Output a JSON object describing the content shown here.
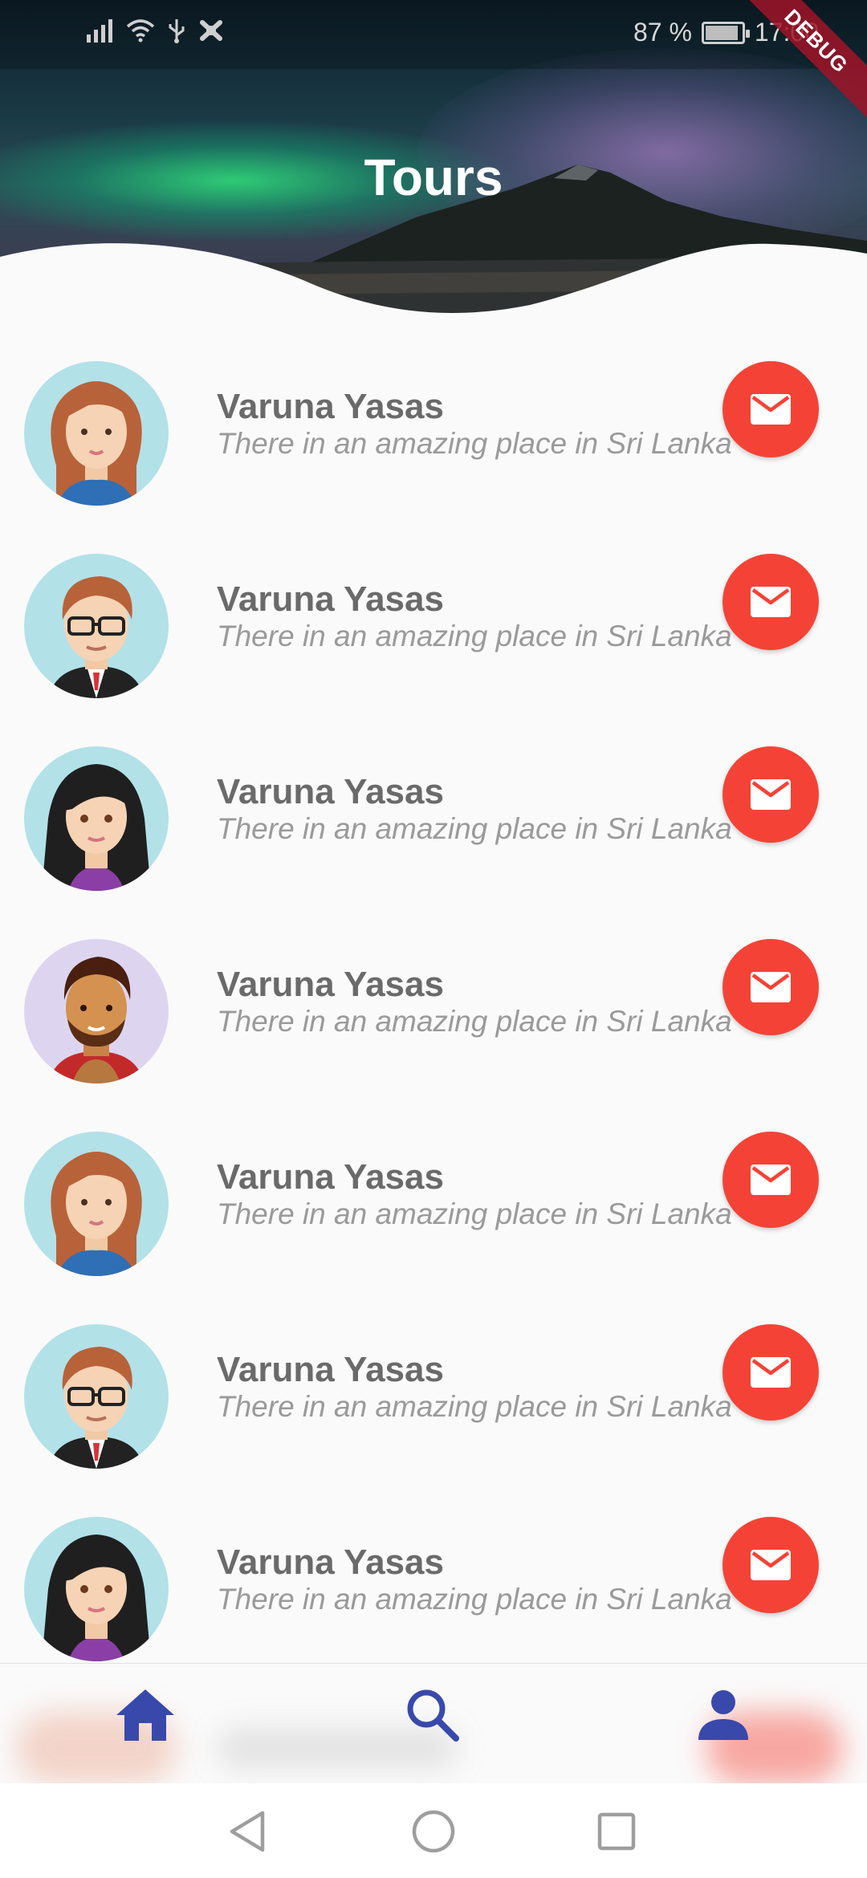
{
  "status_bar": {
    "battery_percent": "87 %",
    "time": "17:00",
    "debug_label": "DEBUG",
    "icons": [
      "signal-icon",
      "wifi-icon",
      "usb-icon",
      "notification-icon"
    ]
  },
  "header": {
    "title": "Tours"
  },
  "tours": [
    {
      "name": "Varuna Yasas",
      "description": "There in an amazing place in Sri Lanka",
      "avatar": "woman-redhair-avatar"
    },
    {
      "name": "Varuna Yasas",
      "description": "There in an amazing place in Sri Lanka",
      "avatar": "man-glasses-avatar"
    },
    {
      "name": "Varuna Yasas",
      "description": "There in an amazing place in Sri Lanka",
      "avatar": "woman-darkhair-avatar"
    },
    {
      "name": "Varuna Yasas",
      "description": "There in an amazing place in Sri Lanka",
      "avatar": "man-beard-avatar"
    },
    {
      "name": "Varuna Yasas",
      "description": "There in an amazing place in Sri Lanka",
      "avatar": "woman-redhair-avatar"
    },
    {
      "name": "Varuna Yasas",
      "description": "There in an amazing place in Sri Lanka",
      "avatar": "man-glasses-avatar"
    },
    {
      "name": "Varuna Yasas",
      "description": "There in an amazing place in Sri Lanka",
      "avatar": "woman-darkhair-avatar"
    }
  ],
  "bottom_nav": {
    "items": [
      {
        "icon": "home-icon",
        "active": true
      },
      {
        "icon": "search-icon",
        "active": false
      },
      {
        "icon": "person-icon",
        "active": false
      }
    ],
    "accent_color": "#3949ab"
  },
  "colors": {
    "mail_button": "#f44336",
    "name_text": "#6a6a6a",
    "subtitle_text": "#9a9a9a"
  },
  "system_nav": [
    "back-icon",
    "home-circle-icon",
    "recents-icon"
  ]
}
